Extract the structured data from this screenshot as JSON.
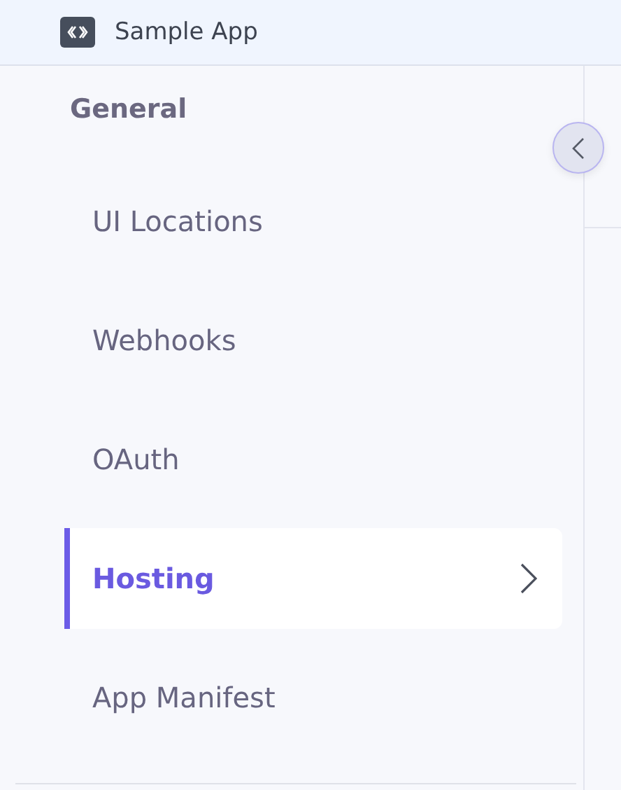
{
  "header": {
    "app_name": "Sample App"
  },
  "sidebar": {
    "heading": "General",
    "items": [
      {
        "label": "UI Locations",
        "selected": false
      },
      {
        "label": "Webhooks",
        "selected": false
      },
      {
        "label": "OAuth",
        "selected": false
      },
      {
        "label": "Hosting",
        "selected": true
      },
      {
        "label": "App Manifest",
        "selected": false
      }
    ]
  }
}
